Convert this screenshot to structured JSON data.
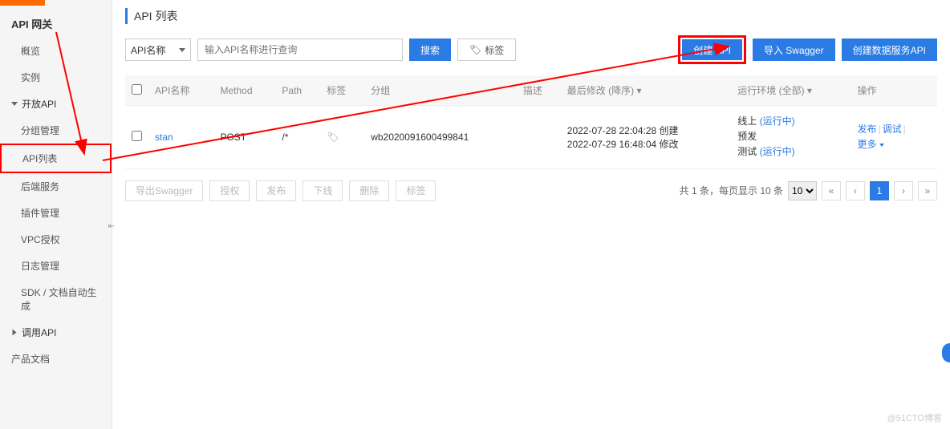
{
  "sidebar": {
    "title": "API 网关",
    "items": [
      {
        "label": "概览",
        "type": "item"
      },
      {
        "label": "实例",
        "type": "item"
      },
      {
        "label": "开放API",
        "type": "group",
        "expanded": true
      },
      {
        "label": "分组管理",
        "type": "sub"
      },
      {
        "label": "API列表",
        "type": "sub",
        "active": true
      },
      {
        "label": "后端服务",
        "type": "sub"
      },
      {
        "label": "插件管理",
        "type": "sub"
      },
      {
        "label": "VPC授权",
        "type": "sub"
      },
      {
        "label": "日志管理",
        "type": "sub"
      },
      {
        "label": "SDK / 文档自动生成",
        "type": "sub"
      },
      {
        "label": "调用API",
        "type": "group",
        "expanded": false
      },
      {
        "label": "产品文档",
        "type": "item"
      }
    ]
  },
  "page": {
    "heading": "API 列表"
  },
  "filter": {
    "select_value": "API名称",
    "input_placeholder": "输入API名称进行查询",
    "search_btn": "搜索",
    "tag_btn": "标签",
    "create_btn": "创建 API",
    "import_btn": "导入 Swagger",
    "create_data_btn": "创建数据服务API"
  },
  "table": {
    "headers": {
      "name": "API名称",
      "method": "Method",
      "path": "Path",
      "tag": "标签",
      "group": "分组",
      "desc": "描述",
      "modified": "最后修改 (降序)",
      "runenv": "运行环境 (全部)",
      "ops": "操作"
    },
    "rows": [
      {
        "name": "stan",
        "method": "POST",
        "path": "/*",
        "group": "wb2020091600499841",
        "created": "2022-07-28 22:04:28 创建",
        "modified": "2022-07-29 16:48:04 修改",
        "env_online": "线上",
        "env_pre": "预发",
        "env_test": "测试",
        "running": "(运行中)"
      }
    ],
    "ops": {
      "publish": "发布",
      "debug": "调试",
      "more": "更多"
    }
  },
  "actions": {
    "export": "导出Swagger",
    "auth": "授权",
    "publish": "发布",
    "offline": "下线",
    "delete": "删除",
    "tag": "标签"
  },
  "pagination": {
    "summary": "共 1 条，每页显示 10 条",
    "size": "10",
    "current": "1"
  },
  "watermark": "@51CTO博客"
}
